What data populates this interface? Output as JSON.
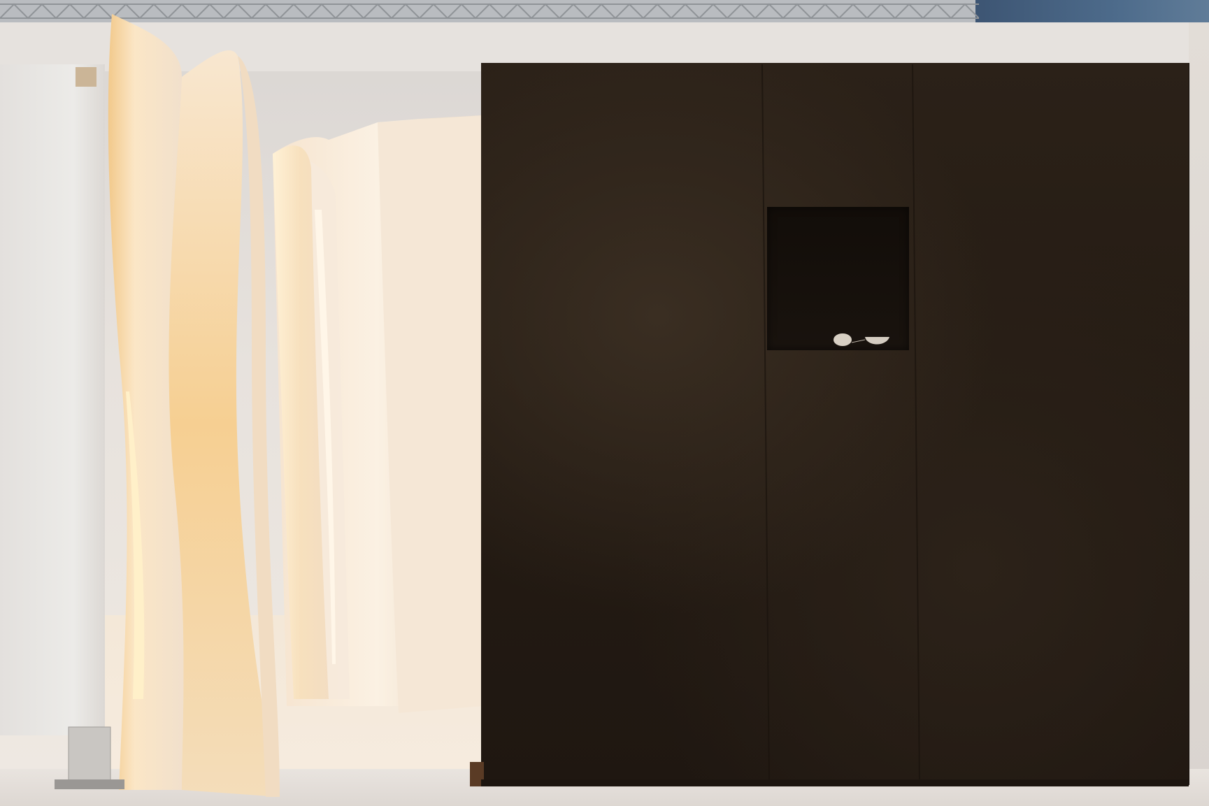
{
  "scene": {
    "palette": {
      "back_wall": "#e6e2de",
      "paper_glow": "#f6d8a8",
      "paper_light": "#f7ece0",
      "black_box": "#241b13",
      "niche": "#14100b",
      "truss": "#b9bcc0",
      "ceiling_blue": "#4d6b8b"
    },
    "objects_in_niche": [
      "cocoon-shaped-object",
      "small-bowl"
    ]
  }
}
